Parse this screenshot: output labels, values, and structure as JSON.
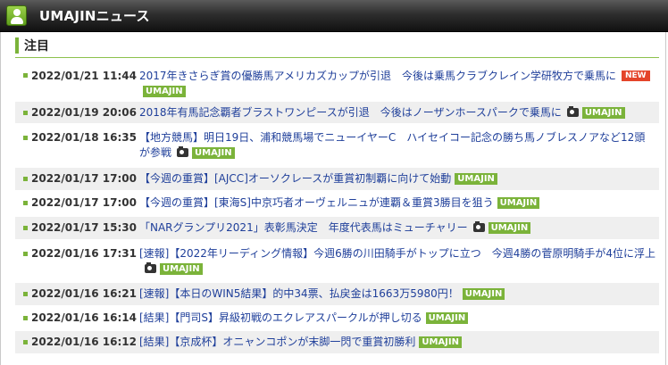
{
  "header": {
    "title": "UMAJINニュース",
    "logo_icon": "horse-person-icon"
  },
  "section": {
    "title": "注目"
  },
  "colors": {
    "accent": "#7bb33a",
    "new_badge": "#e4442a",
    "link": "#1f3f9a"
  },
  "badges": {
    "source": "UMAJIN",
    "new": "NEW"
  },
  "news": [
    {
      "date": "2022/01/21 11:44",
      "title": "2017年きさらぎ賞の優勝馬アメリカズカップが引退　今後は乗馬クラブクレイン学研牧方で乗馬に",
      "new": true,
      "camera": false
    },
    {
      "date": "2022/01/19 20:06",
      "title": "2018年有馬記念覇者ブラストワンピースが引退　今後はノーザンホースパークで乗馬に",
      "new": false,
      "camera": true
    },
    {
      "date": "2022/01/18 16:35",
      "title": "【地方競馬】明日19日、浦和競馬場でニューイヤーC　ハイセイコー記念の勝ち馬ノブレスノアなど12頭が参戦",
      "new": false,
      "camera": true
    },
    {
      "date": "2022/01/17 17:00",
      "title": "【今週の重賞】[AJCC]オーソクレースが重賞初制覇に向けて始動",
      "new": false,
      "camera": false
    },
    {
      "date": "2022/01/17 17:00",
      "title": "【今週の重賞】[東海S]中京巧者オーヴェルニュが連覇＆重賞3勝目を狙う",
      "new": false,
      "camera": false
    },
    {
      "date": "2022/01/17 15:30",
      "title": "「NARグランプリ2021」表彰馬決定　年度代表馬はミューチャリー",
      "new": false,
      "camera": true
    },
    {
      "date": "2022/01/16 17:31",
      "title": "[速報]【2022年リーディング情報】今週6勝の川田騎手がトップに立つ　今週4勝の菅原明騎手が4位に浮上",
      "new": false,
      "camera": true
    },
    {
      "date": "2022/01/16 16:21",
      "title": "[速報]【本日のWIN5結果】的中34票、払戻金は1663万5980円！",
      "new": false,
      "camera": false
    },
    {
      "date": "2022/01/16 16:14",
      "title": "[結果]【門司S】昇級初戦のエクレアスパークルが押し切る",
      "new": false,
      "camera": false
    },
    {
      "date": "2022/01/16 16:12",
      "title": "[結果]【京成杯】オニャンコポンが末脚一閃で重賞初勝利",
      "new": false,
      "camera": false
    }
  ]
}
